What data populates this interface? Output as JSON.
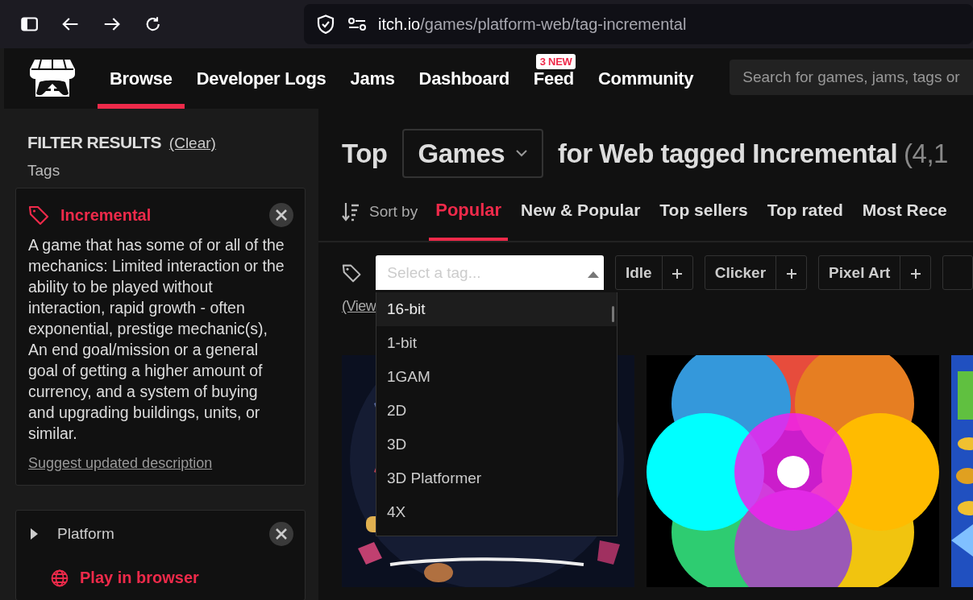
{
  "browser": {
    "url_host": "itch.io",
    "url_path": "/games/platform-web/tag-incremental"
  },
  "nav": {
    "items": [
      {
        "label": "Browse",
        "selected": true
      },
      {
        "label": "Developer Logs",
        "selected": false
      },
      {
        "label": "Jams",
        "selected": false
      },
      {
        "label": "Dashboard",
        "selected": false
      },
      {
        "label": "Feed",
        "selected": false,
        "badge": "3 NEW"
      },
      {
        "label": "Community",
        "selected": false
      }
    ],
    "search": {
      "placeholder": "Search for games, jams, tags or"
    }
  },
  "sidebar": {
    "title": "FILTER RESULTS",
    "clear": "(Clear)",
    "section_label": "Tags",
    "tag_card": {
      "name": "Incremental",
      "description": "A game that has some of or all of the mechanics: Limited interaction or the ability to be played without interaction, rapid growth - often exponential, prestige mechanic(s), An end goal/mission or a general goal of getting a higher amount of currency, and a system of buying and upgrading buildings, units, or similar.",
      "suggest_link": "Suggest updated description"
    },
    "platform": {
      "label": "Platform",
      "expanded": false,
      "option": "Play in browser"
    }
  },
  "main": {
    "heading": {
      "prefix": "Top",
      "type_select": "Games",
      "suffix": "for Web tagged Incremental",
      "count": "(4,1"
    },
    "sort": {
      "label": "Sort by",
      "options": [
        {
          "label": "Popular",
          "selected": true
        },
        {
          "label": "New & Popular",
          "selected": false
        },
        {
          "label": "Top sellers",
          "selected": false
        },
        {
          "label": "Top rated",
          "selected": false
        },
        {
          "label": "Most Rece",
          "selected": false
        }
      ]
    },
    "tag_filter": {
      "placeholder": "Select a tag...",
      "suggested_tags": [
        "Idle",
        "Clicker",
        "Pixel Art"
      ],
      "dropdown": {
        "open": true,
        "options": [
          {
            "label": "16-bit",
            "selected": true
          },
          {
            "label": "1-bit",
            "selected": false
          },
          {
            "label": "1GAM",
            "selected": false
          },
          {
            "label": "2D",
            "selected": false
          },
          {
            "label": "3D",
            "selected": false
          },
          {
            "label": "3D Platformer",
            "selected": false
          },
          {
            "label": "4X",
            "selected": false
          }
        ]
      }
    },
    "view_link": "(View"
  }
}
